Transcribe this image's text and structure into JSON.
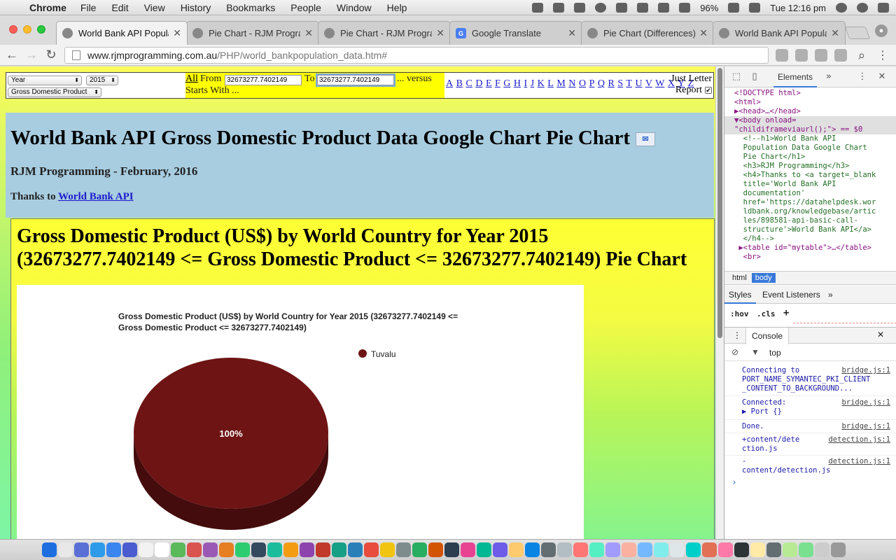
{
  "mac_menubar": {
    "app": "Chrome",
    "menus": [
      "File",
      "Edit",
      "View",
      "History",
      "Bookmarks",
      "People",
      "Window",
      "Help"
    ],
    "battery": "96%",
    "clock": "Tue 12:16 pm"
  },
  "tabs": [
    {
      "title": "World Bank API Populat",
      "favicon": "globe-icon",
      "active": true
    },
    {
      "title": "Pie Chart - RJM Progra",
      "favicon": "globe-icon",
      "active": false
    },
    {
      "title": "Pie Chart - RJM Progra",
      "favicon": "globe-icon",
      "active": false
    },
    {
      "title": "Google Translate",
      "favicon": "google-translate-icon",
      "active": false
    },
    {
      "title": "Pie Chart (Differences)",
      "favicon": "globe-icon",
      "active": false
    },
    {
      "title": "World Bank API Populat",
      "favicon": "globe-icon",
      "active": false
    }
  ],
  "address": {
    "host": "www.rjmprogramming.com.au",
    "path": "/PHP/world_bankpopulation_data.htm#"
  },
  "controls": {
    "select_type": "Year",
    "select_year": "2015",
    "select_indicator": "Gross Domestic Product",
    "all_link": "All",
    "from_label": "From",
    "from_value": "32673277.7402149",
    "to_label": "To",
    "to_value": "32673277.7402149",
    "versus_text": "... versus",
    "starts_with": "Starts With ...",
    "letters": [
      "A",
      "B",
      "C",
      "D",
      "E",
      "F",
      "G",
      "H",
      "I",
      "J",
      "K",
      "L",
      "M",
      "N",
      "O",
      "P",
      "Q",
      "R",
      "S",
      "T",
      "U",
      "V",
      "W",
      "X",
      "Y",
      "Z"
    ],
    "just_letter": "Just Letter",
    "report": "Report",
    "report_checked": "✔"
  },
  "header": {
    "title": "World Bank API Gross Domestic Product Data Google Chart Pie Chart",
    "subtitle": "RJM Programming - February, 2016",
    "thanks_prefix": "Thanks to",
    "thanks_link": "World Bank API"
  },
  "chart_section": {
    "heading": "Gross Domestic Product (US$) by World Country for Year 2015 (32673277.7402149 <= Gross Domestic Product <= 32673277.7402149) Pie Chart"
  },
  "chart_data": {
    "type": "pie",
    "title": "Gross Domestic Product (US$) by World Country for Year 2015 (32673277.7402149 <= Gross Domestic Product <= 32673277.7402149)",
    "slices": [
      {
        "label": "Tuvalu",
        "value": 32673277.7402149,
        "percent_label": "100%",
        "color": "#6e1414"
      }
    ],
    "legend": "right",
    "is3D": true
  },
  "devtools": {
    "panel": "Elements",
    "dom_lines": [
      {
        "cls": "",
        "text": "<!DOCTYPE html>"
      },
      {
        "cls": "",
        "text": "<html>"
      },
      {
        "cls": "",
        "text": "▶<head>…</head>"
      },
      {
        "cls": "sel-row",
        "text": "▼<body onload="
      },
      {
        "cls": "sel-row",
        "text": "\"childiframeviaurl();\"> == $0"
      },
      {
        "cls": "c",
        "text": "  <!--h1>World Bank API"
      },
      {
        "cls": "c",
        "text": "  Population Data Google Chart"
      },
      {
        "cls": "c",
        "text": "  Pie Chart</h1>"
      },
      {
        "cls": "c",
        "text": "  <h3>RJM Programming</h3>"
      },
      {
        "cls": "c",
        "text": "  <h4>Thanks to <a target=_blank"
      },
      {
        "cls": "c",
        "text": "  title='World Bank API"
      },
      {
        "cls": "c",
        "text": "  documentation'"
      },
      {
        "cls": "c",
        "text": "  href='https://datahelpdesk.wor"
      },
      {
        "cls": "c",
        "text": "  ldbank.org/knowledgebase/artic"
      },
      {
        "cls": "c",
        "text": "  les/898581-api-basic-call-"
      },
      {
        "cls": "c",
        "text": "  structure'>World Bank API</a>"
      },
      {
        "cls": "c",
        "text": "  </h4-->"
      },
      {
        "cls": "",
        "text": " ▶<table id=\"mytable\">…</table>"
      },
      {
        "cls": "",
        "text": "  <br>"
      }
    ],
    "crumbs": [
      "html",
      "body"
    ],
    "styles_tab": "Styles",
    "listeners_tab": "Event Listeners",
    "hov": ":hov",
    "cls": ".cls",
    "plus": "+",
    "console_title": "Console",
    "console_context": "top",
    "messages": [
      {
        "text": "Connecting to\nPORT_NAME_SYMANTEC_PKI_CLIENT\n_CONTENT_TO_BACKGROUND...",
        "src": "bridge.js:1"
      },
      {
        "text": "Connected:\n▶ Port {}",
        "src": "bridge.js:1"
      },
      {
        "text": "Done.",
        "src": "bridge.js:1"
      },
      {
        "text": "+content/dete\nction.js",
        "src": "detection.js:1"
      },
      {
        "text": "-\ncontent/detection.js",
        "src": "detection.js:1"
      }
    ],
    "prompt": "›"
  }
}
